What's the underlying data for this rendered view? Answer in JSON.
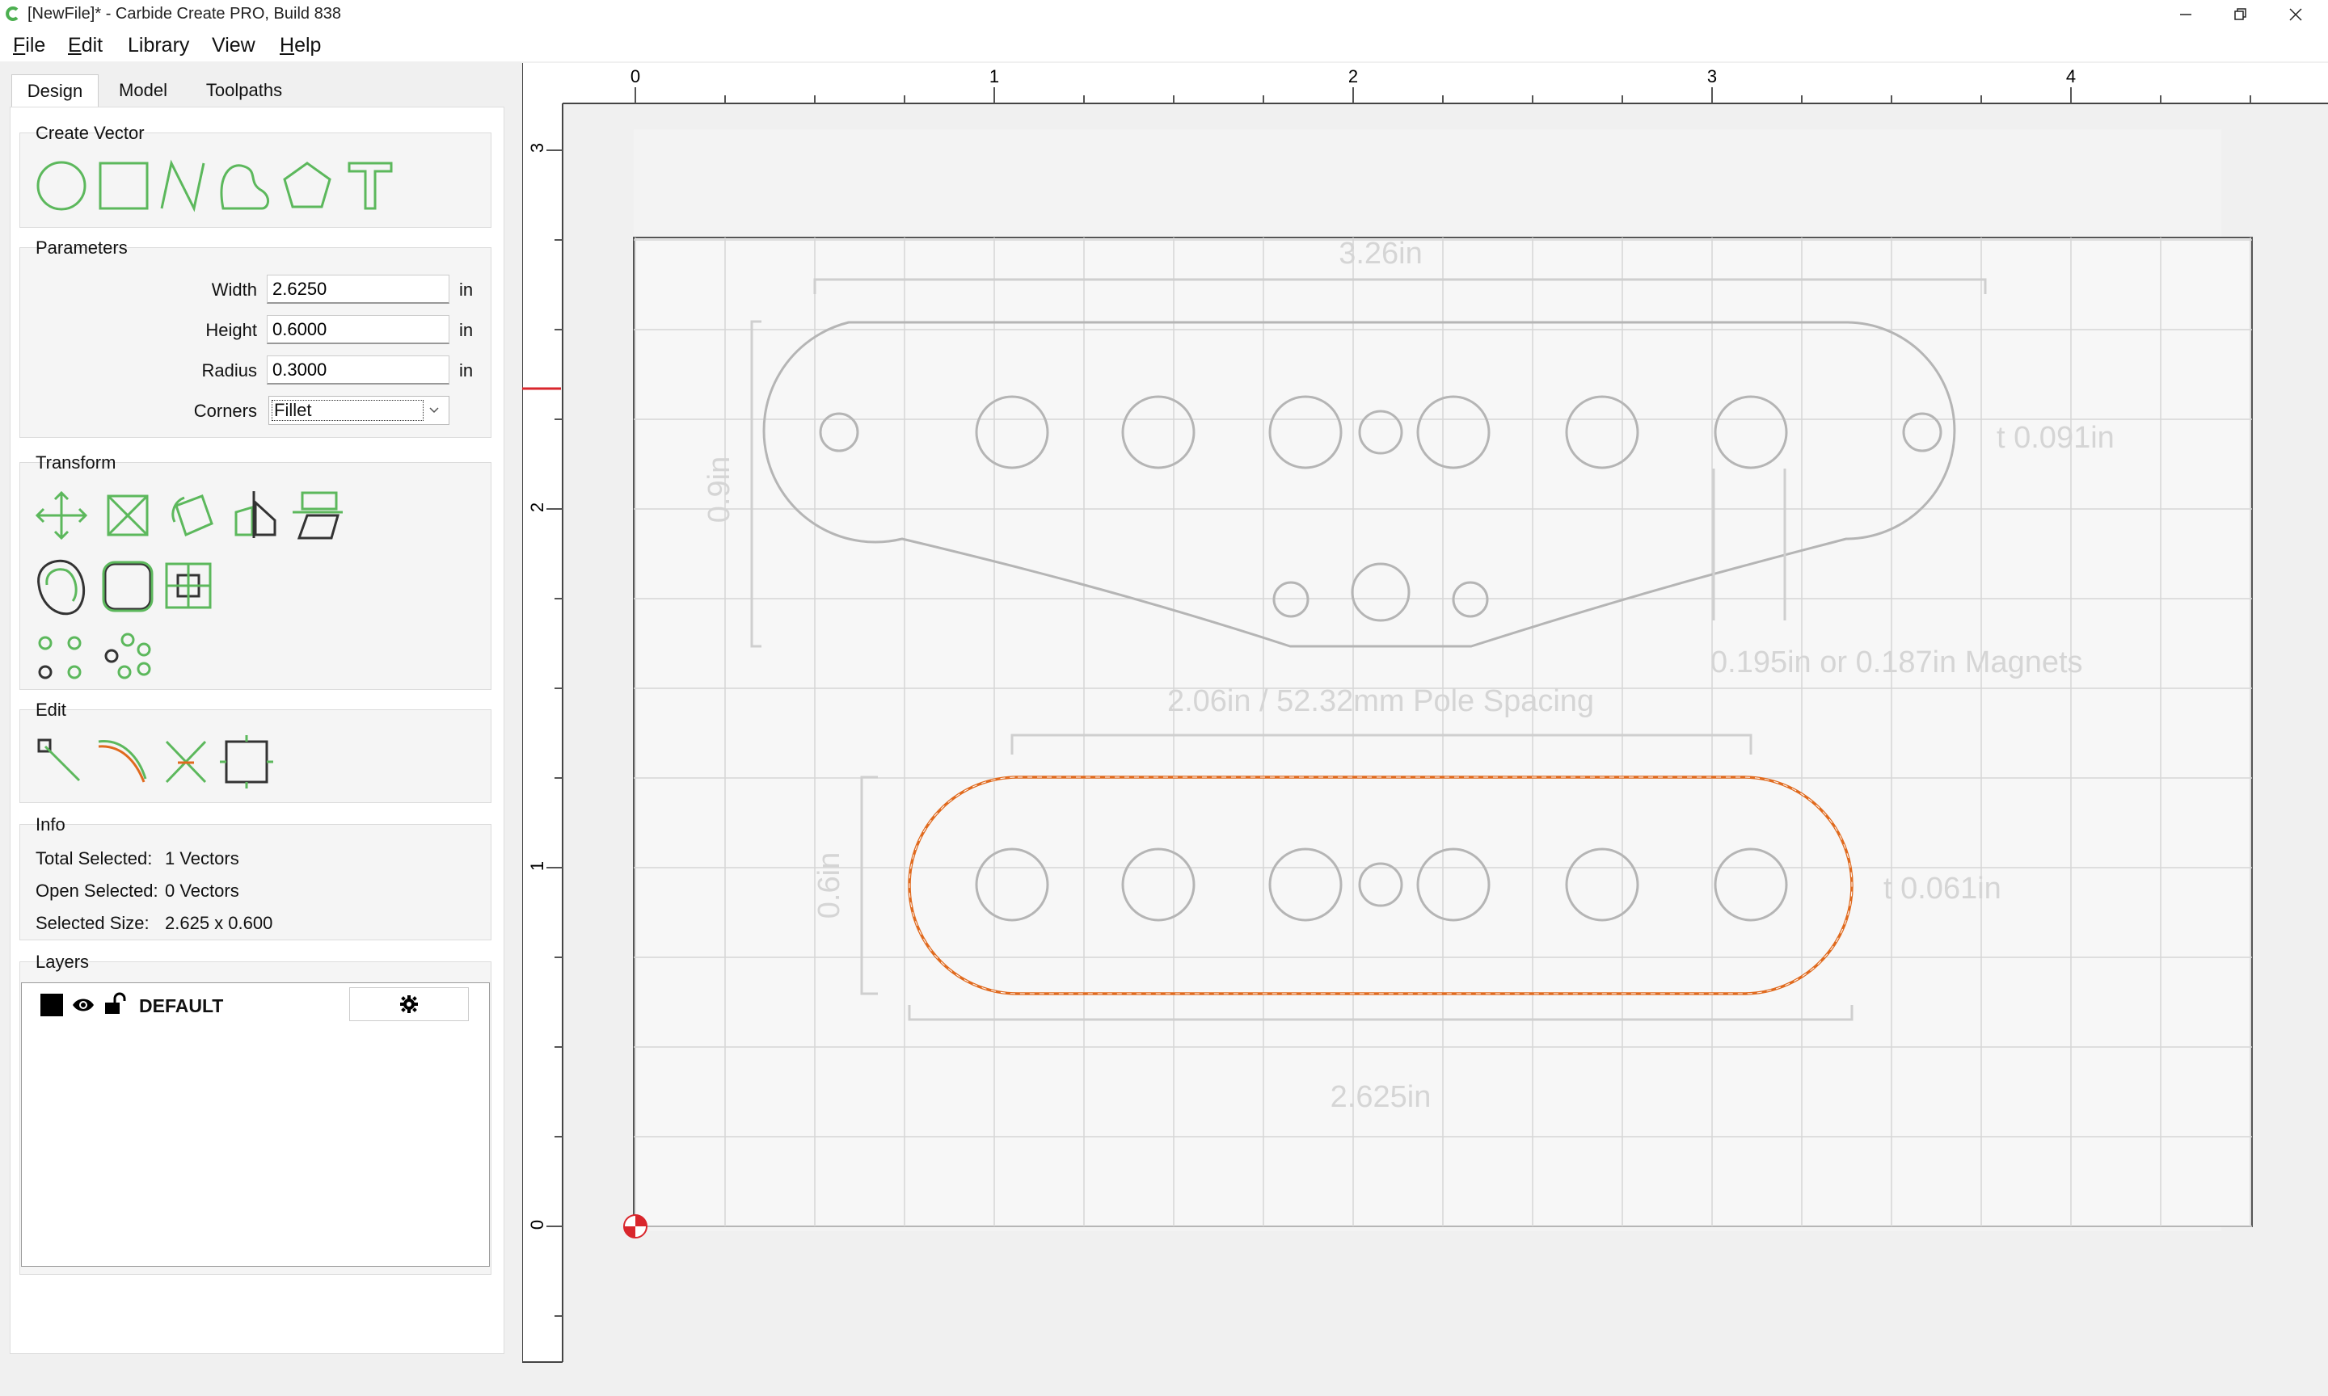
{
  "window": {
    "title": "[NewFile]* - Carbide Create PRO, Build 838",
    "controls": [
      "minimize",
      "restore",
      "close"
    ]
  },
  "menu": [
    {
      "label": "File",
      "key": "F",
      "rest": "ile"
    },
    {
      "label": "Edit",
      "key": "E",
      "rest": "dit"
    },
    {
      "label": "Library",
      "key": "",
      "rest": "Library"
    },
    {
      "label": "View",
      "key": "",
      "rest": "View"
    },
    {
      "label": "Help",
      "key": "H",
      "rest": "elp"
    }
  ],
  "tabs": [
    "Design",
    "Model",
    "Toolpaths"
  ],
  "create_vector": {
    "title": "Create Vector",
    "tools": [
      "circle-icon",
      "rectangle-icon",
      "polyline-icon",
      "curve-icon",
      "polygon-icon",
      "text-icon"
    ]
  },
  "parameters": {
    "title": "Parameters",
    "width_label": "Width",
    "width_value": "2.6250",
    "height_label": "Height",
    "height_value": "0.6000",
    "radius_label": "Radius",
    "radius_value": "0.3000",
    "corners_label": "Corners",
    "corners_value": "Fillet",
    "unit": "in"
  },
  "transform": {
    "title": "Transform",
    "tools": [
      "move-icon",
      "scale-icon",
      "rotate-icon",
      "mirror-icon",
      "align-icon",
      "offset-icon",
      "fillet-icon",
      "boolean-icon",
      "circular-array-icon",
      "linear-array-icon"
    ]
  },
  "edit": {
    "title": "Edit",
    "tools": [
      "node-edit-icon",
      "trim-icon",
      "cut-icon",
      "join-icon"
    ]
  },
  "info": {
    "title": "Info",
    "total_label": "Total Selected:",
    "total_value": "1 Vectors",
    "open_label": "Open Selected:",
    "open_value": "0 Vectors",
    "size_label": "Selected Size:",
    "size_value": "2.625 x 0.600"
  },
  "layers": {
    "title": "Layers",
    "items": [
      {
        "name": "DEFAULT",
        "color": "#000000"
      }
    ]
  },
  "colors": {
    "accent_green": "#5cb85c",
    "selection_orange": "#e06a1e",
    "ruler_marker": "#d9262c",
    "grid": "#d6d6d6"
  },
  "canvas": {
    "ruler_x_labels": [
      "0",
      "1",
      "2",
      "3",
      "4"
    ],
    "ruler_y_labels": [
      "3",
      "2",
      "1",
      "0"
    ],
    "annotations": {
      "top_width": "3.26in",
      "top_height": "0.9in",
      "top_thickness": "t 0.091in",
      "magnets": "0.195in or 0.187in Magnets",
      "pole_spacing": "2.06in / 52.32mm Pole Spacing",
      "bottom_height": "0.6in",
      "bottom_thickness": "t 0.061in",
      "bottom_width": "2.625in"
    }
  }
}
